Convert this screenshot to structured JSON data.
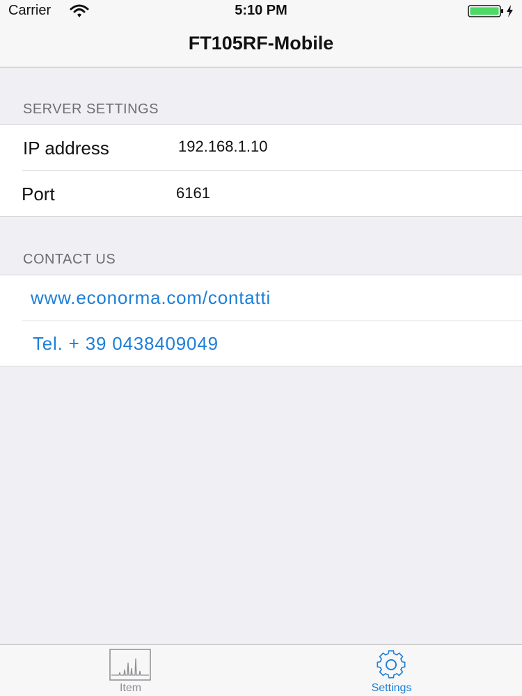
{
  "status_bar": {
    "carrier": "Carrier",
    "time": "5:10 PM",
    "wifi_icon": "wifi-icon",
    "battery_icon": "battery-charging-icon"
  },
  "nav": {
    "title": "FT105RF-Mobile"
  },
  "server_settings": {
    "header": "SERVER SETTINGS",
    "ip_label": "IP address",
    "ip_value": "192.168.1.10",
    "port_label": "Port",
    "port_value": "6161"
  },
  "contact": {
    "header": "CONTACT US",
    "website": "www.econorma.com/contatti",
    "phone": "Tel. + 39 0438409049"
  },
  "tab_bar": {
    "tabs": [
      {
        "label": "Item",
        "icon": "spectrum-chart-icon",
        "selected": false
      },
      {
        "label": "Settings",
        "icon": "gear-icon",
        "selected": true
      }
    ]
  },
  "colors": {
    "accent": "#1d7fd9",
    "background": "#efeff4",
    "inactive_tab": "#8e8e93"
  }
}
